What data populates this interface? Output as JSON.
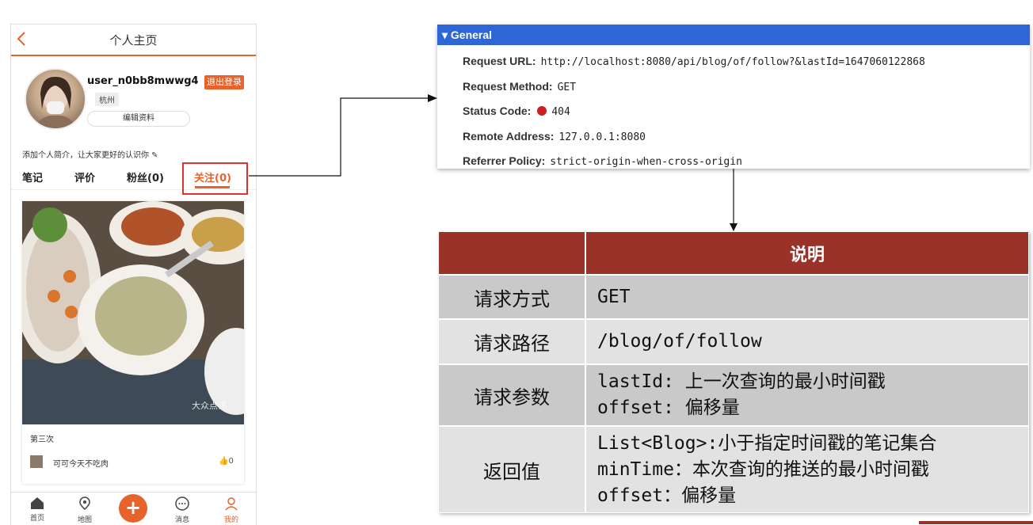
{
  "phone": {
    "header_title": "个人主页",
    "username": "user_n0bb8mwwg4",
    "logout_label": "退出登录",
    "city": "杭州",
    "edit_label": "编辑资料",
    "intro": "添加个人简介，让大家更好的认识你 ✎",
    "tabs": [
      "笔记",
      "评价",
      "粉丝(0)",
      "关注(0)"
    ],
    "card": {
      "title": "第三次",
      "author": "可可今天不吃肉",
      "likes": "0",
      "watermark": "大众点评"
    },
    "nav": [
      "首页",
      "地图",
      "消息",
      "我的"
    ]
  },
  "devtools": {
    "section": "▾ General",
    "rows": [
      {
        "key": "Request URL:",
        "value": "http://localhost:8080/api/blog/of/follow?&lastId=1647060122868"
      },
      {
        "key": "Request Method:",
        "value": "GET"
      },
      {
        "key": "Status Code:",
        "value": "404"
      },
      {
        "key": "Remote Address:",
        "value": "127.0.0.1:8080"
      },
      {
        "key": "Referrer Policy:",
        "value": "strict-origin-when-cross-origin"
      }
    ],
    "status_color": "#cc1f1f"
  },
  "table": {
    "header": "说明",
    "rows": [
      {
        "label": "请求方式",
        "lines": [
          "GET"
        ]
      },
      {
        "label": "请求路径",
        "lines": [
          "/blog/of/follow"
        ]
      },
      {
        "label": "请求参数",
        "lines": [
          "lastId: 上一次查询的最小时间戳",
          "offset: 偏移量"
        ]
      },
      {
        "label": "返回值",
        "lines": [
          "List<Blog>:小于指定时间戳的笔记集合",
          "minTime：本次查询的推送的最小时间戳",
          "offset：偏移量"
        ]
      }
    ],
    "header_color": "#9a3327"
  }
}
